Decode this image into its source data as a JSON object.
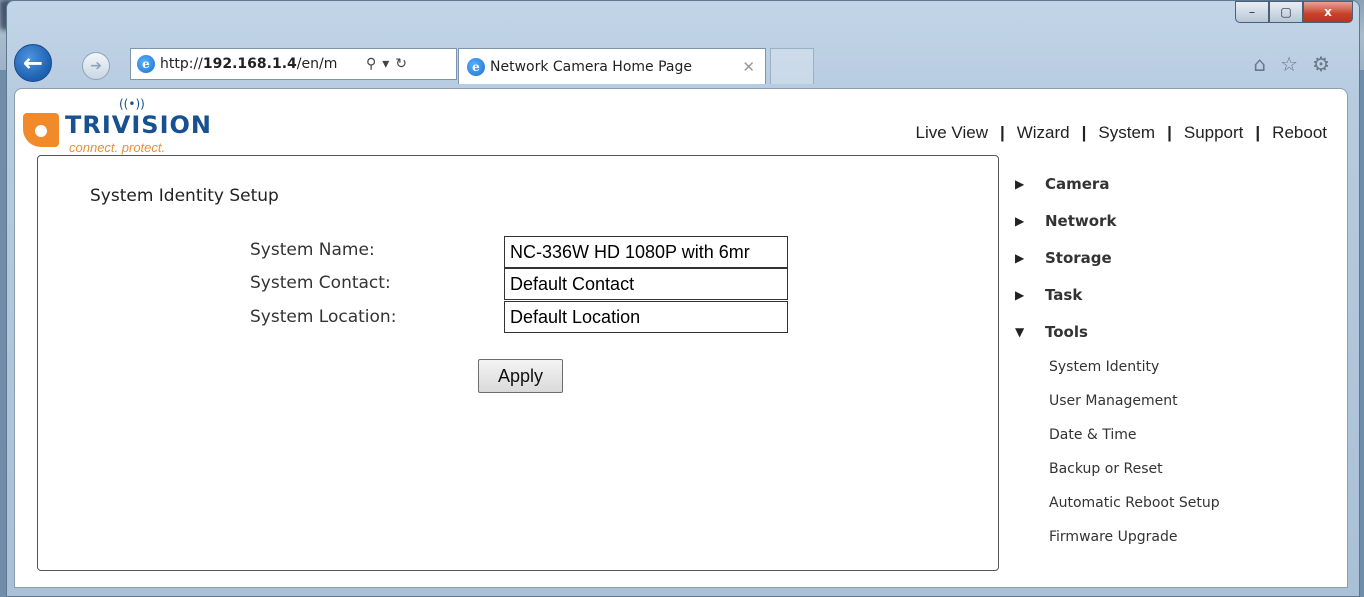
{
  "browser": {
    "url_prefix": "http://",
    "url_host": "192.168.1.4",
    "url_path": "/en/m",
    "tab_title": "Network Camera Home Page",
    "tab_close": "✕",
    "window_controls": {
      "minimize": "–",
      "maximize": "▢",
      "close": "x"
    }
  },
  "header": {
    "logo_text": "TRIVISION",
    "tagline": "connect. protect.",
    "menu": [
      "Live View",
      "Wizard",
      "System",
      "Support",
      "Reboot"
    ]
  },
  "form": {
    "title": "System Identity Setup",
    "fields": [
      {
        "label": "System Name:",
        "value": "NC-336W HD 1080P with 6mr"
      },
      {
        "label": "System Contact:",
        "value": "Default Contact"
      },
      {
        "label": "System Location:",
        "value": "Default Location"
      }
    ],
    "apply_label": "Apply"
  },
  "sidebar": {
    "items": [
      {
        "label": "Camera",
        "arrow": "▶"
      },
      {
        "label": "Network",
        "arrow": "▶"
      },
      {
        "label": "Storage",
        "arrow": "▶"
      },
      {
        "label": "Task",
        "arrow": "▶"
      },
      {
        "label": "Tools",
        "arrow": "▼"
      }
    ],
    "subitems": [
      "System Identity",
      "User Management",
      "Date & Time",
      "Backup or Reset",
      "Automatic Reboot Setup",
      "Firmware Upgrade"
    ]
  },
  "colors": {
    "accent": "#17518f",
    "logo_orange": "#f08a2a",
    "window_frame": "#b7cbe0"
  }
}
